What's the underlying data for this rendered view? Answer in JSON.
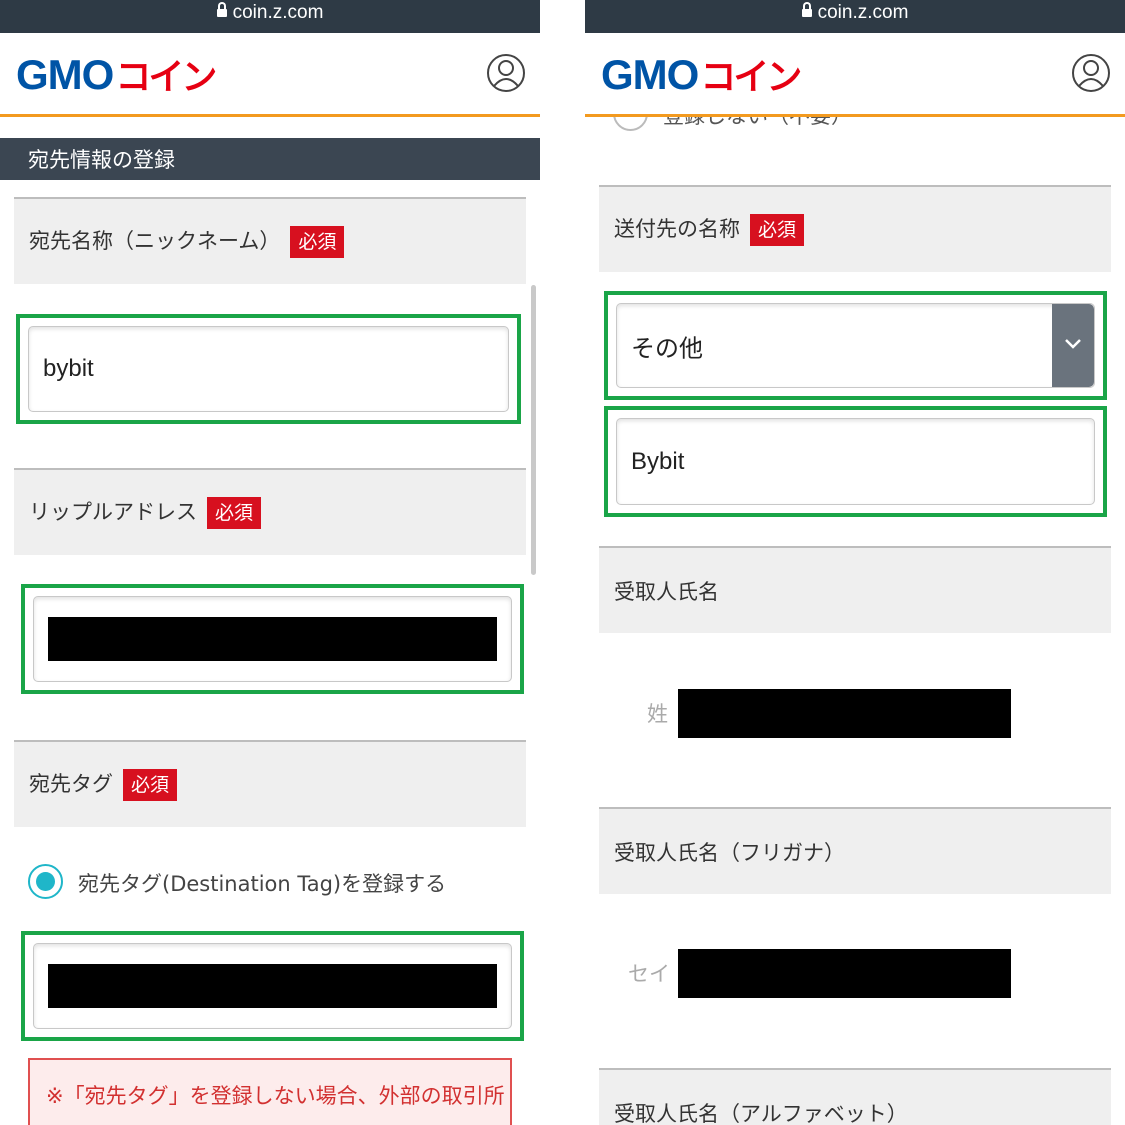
{
  "url": "coin.z.com",
  "brand": {
    "latin": "GMO",
    "kana": "コイン"
  },
  "colors": {
    "accent_orange": "#f39a1f",
    "brand_blue": "#0054a6",
    "brand_red": "#e60012",
    "required_red": "#d7101f",
    "highlight_green": "#1aa548",
    "radio_cyan": "#1fb6c9"
  },
  "left": {
    "section_title": "宛先情報の登録",
    "fields": {
      "nickname": {
        "label": "宛先名称（ニックネーム）",
        "required": "必須",
        "value": "bybit"
      },
      "ripple_address": {
        "label": "リップルアドレス",
        "required": "必須"
      },
      "destination_tag": {
        "label": "宛先タグ",
        "required": "必須",
        "radio_label": "宛先タグ(Destination Tag)を登録する"
      }
    },
    "note": "※「宛先タグ」を登録しない場合、外部の取引所"
  },
  "right": {
    "cut_radio_label": "登録しない（不要）",
    "fields": {
      "recipient_name": {
        "label": "送付先の名称",
        "required": "必須",
        "select_value": "その他",
        "input_value": "Bybit"
      },
      "receiver_name": {
        "label": "受取人氏名",
        "sub_label": "姓"
      },
      "receiver_kana": {
        "label": "受取人氏名（フリガナ）",
        "sub_label": "セイ"
      },
      "receiver_alpha": {
        "label": "受取人氏名（アルファベット）"
      }
    }
  }
}
